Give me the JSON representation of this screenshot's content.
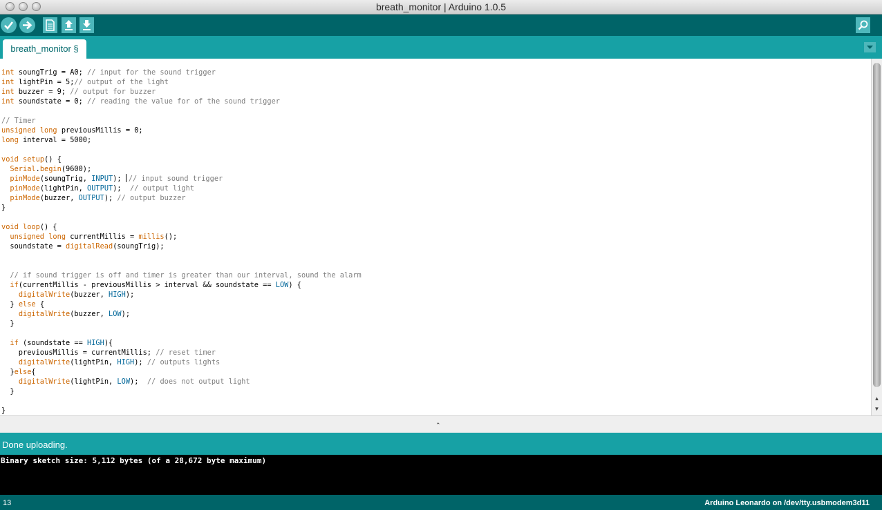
{
  "window": {
    "title": "breath_monitor | Arduino 1.0.5"
  },
  "toolbar": {
    "buttons": [
      {
        "name": "verify",
        "icon": "check-icon"
      },
      {
        "name": "upload",
        "icon": "arrow-right-icon"
      },
      {
        "name": "new",
        "icon": "document-icon"
      },
      {
        "name": "open",
        "icon": "arrow-up-icon"
      },
      {
        "name": "save",
        "icon": "arrow-down-icon"
      },
      {
        "name": "serial-monitor",
        "icon": "magnifier-icon"
      }
    ]
  },
  "tabs": [
    {
      "label": "breath_monitor §"
    }
  ],
  "editor": {
    "lines": [
      [
        {
          "t": "int",
          "c": "kw"
        },
        {
          "t": " soungTrig = A0; ",
          "c": ""
        },
        {
          "t": "// input for the sound trigger",
          "c": "cm"
        }
      ],
      [
        {
          "t": "int",
          "c": "kw"
        },
        {
          "t": " lightPin = 5;",
          "c": ""
        },
        {
          "t": "// output of the light",
          "c": "cm"
        }
      ],
      [
        {
          "t": "int",
          "c": "kw"
        },
        {
          "t": " buzzer = 9; ",
          "c": ""
        },
        {
          "t": "// output for buzzer",
          "c": "cm"
        }
      ],
      [
        {
          "t": "int",
          "c": "kw"
        },
        {
          "t": " soundstate = 0; ",
          "c": ""
        },
        {
          "t": "// reading the value for of the sound trigger",
          "c": "cm"
        }
      ],
      [],
      [
        {
          "t": "// Timer",
          "c": "cm"
        }
      ],
      [
        {
          "t": "unsigned",
          "c": "kw"
        },
        {
          "t": " ",
          "c": ""
        },
        {
          "t": "long",
          "c": "kw"
        },
        {
          "t": " previousMillis = 0;",
          "c": ""
        }
      ],
      [
        {
          "t": "long",
          "c": "kw"
        },
        {
          "t": " interval = 5000;",
          "c": ""
        }
      ],
      [],
      [
        {
          "t": "void",
          "c": "kw"
        },
        {
          "t": " ",
          "c": ""
        },
        {
          "t": "setup",
          "c": "kw"
        },
        {
          "t": "() {",
          "c": ""
        }
      ],
      [
        {
          "t": "  ",
          "c": ""
        },
        {
          "t": "Serial",
          "c": "kw"
        },
        {
          "t": ".",
          "c": ""
        },
        {
          "t": "begin",
          "c": "kw"
        },
        {
          "t": "(9600);",
          "c": ""
        }
      ],
      [
        {
          "t": "  ",
          "c": ""
        },
        {
          "t": "pinMode",
          "c": "kw"
        },
        {
          "t": "(soungTrig, ",
          "c": ""
        },
        {
          "t": "INPUT",
          "c": "ct"
        },
        {
          "t": "); ",
          "c": ""
        },
        {
          "t": "",
          "c": "caret"
        },
        {
          "t": "// input sound trigger",
          "c": "cm"
        }
      ],
      [
        {
          "t": "  ",
          "c": ""
        },
        {
          "t": "pinMode",
          "c": "kw"
        },
        {
          "t": "(lightPin, ",
          "c": ""
        },
        {
          "t": "OUTPUT",
          "c": "ct"
        },
        {
          "t": ");  ",
          "c": ""
        },
        {
          "t": "// output light",
          "c": "cm"
        }
      ],
      [
        {
          "t": "  ",
          "c": ""
        },
        {
          "t": "pinMode",
          "c": "kw"
        },
        {
          "t": "(buzzer, ",
          "c": ""
        },
        {
          "t": "OUTPUT",
          "c": "ct"
        },
        {
          "t": "); ",
          "c": ""
        },
        {
          "t": "// output buzzer",
          "c": "cm"
        }
      ],
      [
        {
          "t": "}",
          "c": ""
        }
      ],
      [],
      [
        {
          "t": "void",
          "c": "kw"
        },
        {
          "t": " ",
          "c": ""
        },
        {
          "t": "loop",
          "c": "kw"
        },
        {
          "t": "() {",
          "c": ""
        }
      ],
      [
        {
          "t": "  ",
          "c": ""
        },
        {
          "t": "unsigned",
          "c": "kw"
        },
        {
          "t": " ",
          "c": ""
        },
        {
          "t": "long",
          "c": "kw"
        },
        {
          "t": " currentMillis = ",
          "c": ""
        },
        {
          "t": "millis",
          "c": "kw"
        },
        {
          "t": "();",
          "c": ""
        }
      ],
      [
        {
          "t": "  soundstate = ",
          "c": ""
        },
        {
          "t": "digitalRead",
          "c": "kw"
        },
        {
          "t": "(soungTrig);",
          "c": ""
        }
      ],
      [],
      [],
      [
        {
          "t": "  ",
          "c": ""
        },
        {
          "t": "// if sound trigger is off and timer is greater than our interval, sound the alarm",
          "c": "cm"
        }
      ],
      [
        {
          "t": "  ",
          "c": ""
        },
        {
          "t": "if",
          "c": "kw"
        },
        {
          "t": "(currentMillis - previousMillis > interval && soundstate == ",
          "c": ""
        },
        {
          "t": "LOW",
          "c": "ct"
        },
        {
          "t": ") {",
          "c": ""
        }
      ],
      [
        {
          "t": "    ",
          "c": ""
        },
        {
          "t": "digitalWrite",
          "c": "kw"
        },
        {
          "t": "(buzzer, ",
          "c": ""
        },
        {
          "t": "HIGH",
          "c": "ct"
        },
        {
          "t": ");",
          "c": ""
        }
      ],
      [
        {
          "t": "  } ",
          "c": ""
        },
        {
          "t": "else",
          "c": "kw"
        },
        {
          "t": " {",
          "c": ""
        }
      ],
      [
        {
          "t": "    ",
          "c": ""
        },
        {
          "t": "digitalWrite",
          "c": "kw"
        },
        {
          "t": "(buzzer, ",
          "c": ""
        },
        {
          "t": "LOW",
          "c": "ct"
        },
        {
          "t": ");",
          "c": ""
        }
      ],
      [
        {
          "t": "  }",
          "c": ""
        }
      ],
      [],
      [
        {
          "t": "  ",
          "c": ""
        },
        {
          "t": "if",
          "c": "kw"
        },
        {
          "t": " (soundstate == ",
          "c": ""
        },
        {
          "t": "HIGH",
          "c": "ct"
        },
        {
          "t": "){",
          "c": ""
        }
      ],
      [
        {
          "t": "    previousMillis = currentMillis; ",
          "c": ""
        },
        {
          "t": "// reset timer",
          "c": "cm"
        }
      ],
      [
        {
          "t": "    ",
          "c": ""
        },
        {
          "t": "digitalWrite",
          "c": "kw"
        },
        {
          "t": "(lightPin, ",
          "c": ""
        },
        {
          "t": "HIGH",
          "c": "ct"
        },
        {
          "t": "); ",
          "c": ""
        },
        {
          "t": "// outputs lights",
          "c": "cm"
        }
      ],
      [
        {
          "t": "  }",
          "c": ""
        },
        {
          "t": "else",
          "c": "kw"
        },
        {
          "t": "{",
          "c": ""
        }
      ],
      [
        {
          "t": "    ",
          "c": ""
        },
        {
          "t": "digitalWrite",
          "c": "kw"
        },
        {
          "t": "(lightPin, ",
          "c": ""
        },
        {
          "t": "LOW",
          "c": "ct"
        },
        {
          "t": ");  ",
          "c": ""
        },
        {
          "t": "// does not output light",
          "c": "cm"
        }
      ],
      [
        {
          "t": "  }",
          "c": ""
        }
      ],
      [],
      [
        {
          "t": "}",
          "c": ""
        }
      ]
    ]
  },
  "status": {
    "message": "Done uploading."
  },
  "console": {
    "output": "Binary sketch size: 5,112 bytes (of a 28,672 byte maximum)"
  },
  "footer": {
    "line_number": "13",
    "board": "Arduino Leonardo on /dev/tty.usbmodem3d11"
  },
  "colors": {
    "toolbar": "#006468",
    "tabbar": "#17a1a5",
    "keyword": "#cc6600",
    "comment": "#7e7e7e",
    "constant": "#006699"
  }
}
